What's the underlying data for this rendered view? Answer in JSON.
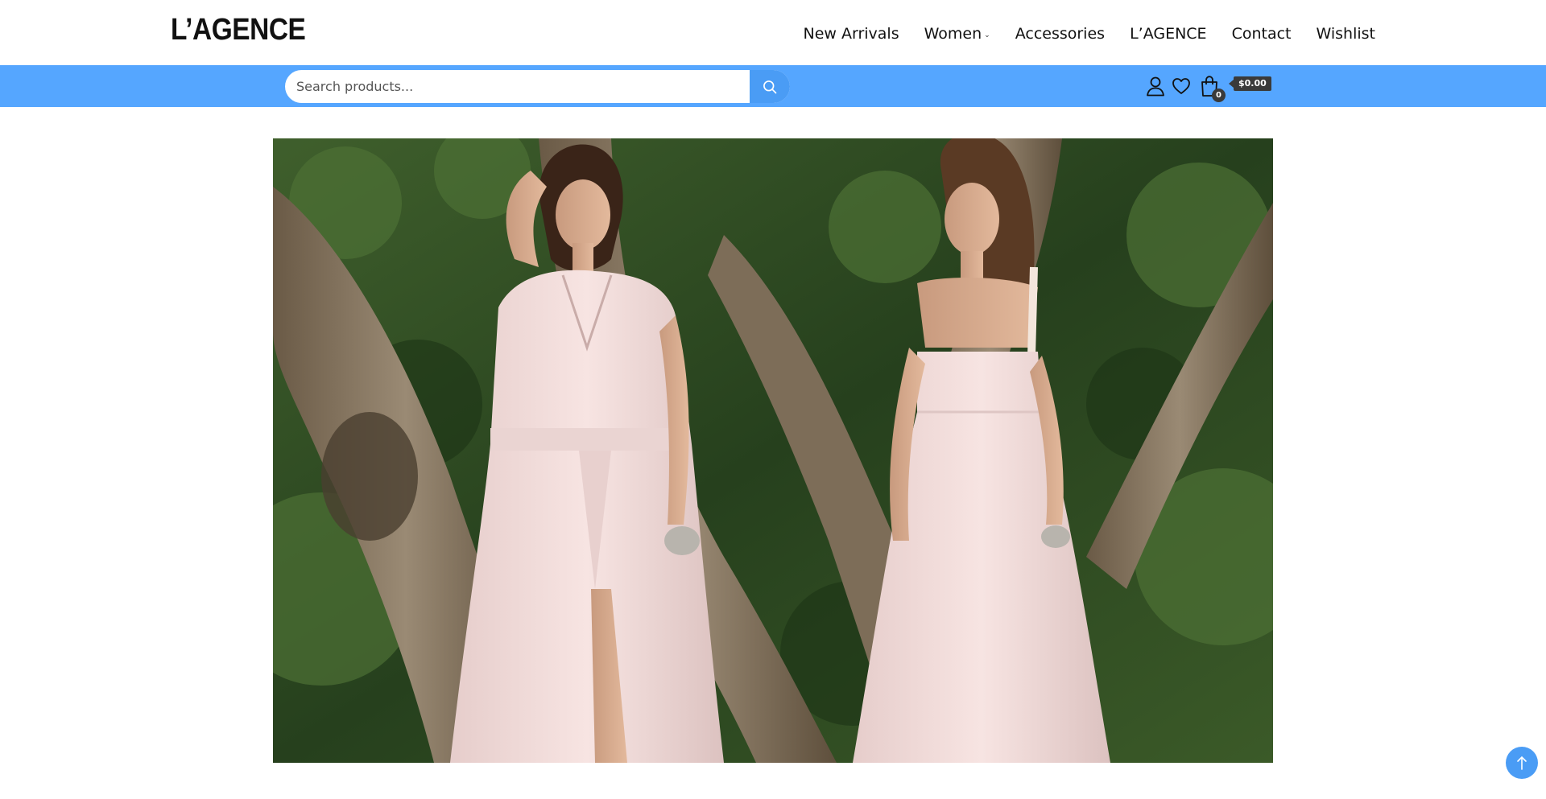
{
  "brand": {
    "logo_text": "L’AGENCE"
  },
  "nav": {
    "items": [
      {
        "label": "New Arrivals"
      },
      {
        "label": "Women",
        "has_dropdown": true
      },
      {
        "label": "Accessories"
      },
      {
        "label": "L’AGENCE"
      },
      {
        "label": "Contact"
      },
      {
        "label": "Wishlist"
      }
    ]
  },
  "search": {
    "placeholder": "Search products...",
    "value": ""
  },
  "cart": {
    "count": "0",
    "total": "$0.00"
  },
  "icons": {
    "search": "search-icon",
    "account": "user-icon",
    "wishlist": "heart-icon",
    "cart": "shopping-bag-icon",
    "scroll_top": "arrow-up-icon",
    "dropdown": "chevron-down-icon"
  },
  "colors": {
    "search_band": "#55a6ff",
    "search_button": "#4a9cf5",
    "badge": "#3a3a3a",
    "scroll_top_button": "#4a9cf5"
  },
  "hero": {
    "image_subject": "two models in pale pink dresses in front of a tree"
  }
}
